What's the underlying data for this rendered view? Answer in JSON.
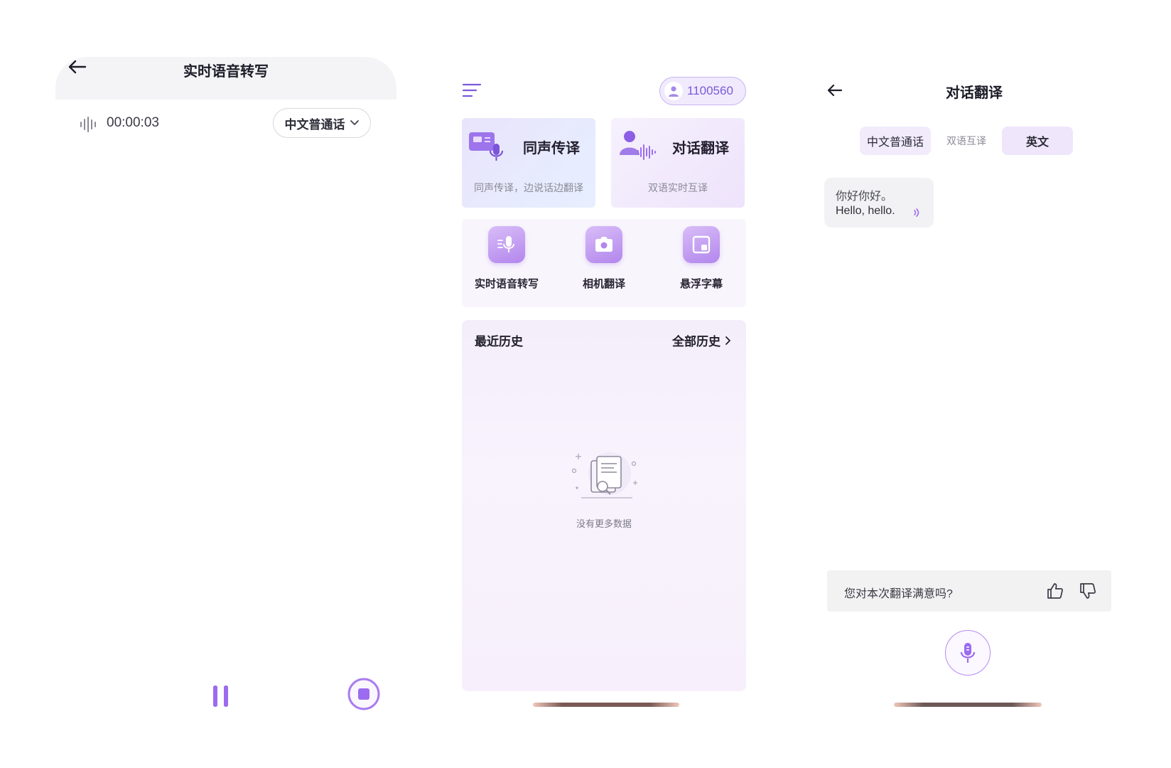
{
  "theme": {
    "accent": "#9b6cf0",
    "accent_light": "#efe6fc"
  },
  "panel1": {
    "title": "实时语音转写",
    "timer": "00:00:03",
    "language": "中文普通话",
    "icons": [
      "back-arrow-icon",
      "waveform-icon",
      "chevron-down-icon",
      "pause-icon",
      "stop-icon"
    ]
  },
  "panel2": {
    "user_id": "1100560",
    "cards": [
      {
        "title": "同声传译",
        "subtitle": "同声传译，边说话边翻译"
      },
      {
        "title": "对话翻译",
        "subtitle": "双语实时互译"
      }
    ],
    "tools": [
      {
        "label": "实时语音转写",
        "icon": "mic-icon"
      },
      {
        "label": "相机翻译",
        "icon": "camera-icon"
      },
      {
        "label": "悬浮字幕",
        "icon": "floating-window-icon"
      }
    ],
    "history": {
      "title": "最近历史",
      "all_link": "全部历史",
      "empty_text": "没有更多数据"
    }
  },
  "panel3": {
    "title": "对话翻译",
    "lang_left": "中文普通话",
    "lang_mid": "双语互译",
    "lang_right": "英文",
    "message": {
      "source": "你好你好。",
      "translation": "Hello, hello."
    },
    "feedback_question": "您对本次翻译满意吗?"
  }
}
